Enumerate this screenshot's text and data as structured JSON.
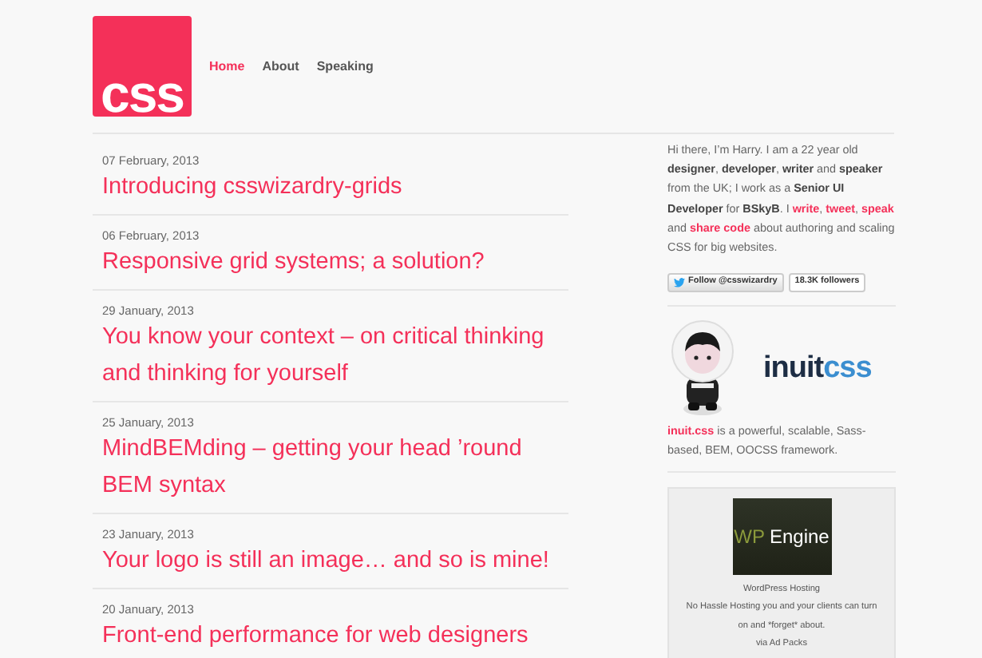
{
  "logo": {
    "text": "css"
  },
  "nav": [
    {
      "label": "Home",
      "selected": true
    },
    {
      "label": "About",
      "selected": false
    },
    {
      "label": "Speaking",
      "selected": false
    }
  ],
  "posts": [
    {
      "date": "07 February, 2013",
      "title": "Introducing csswizardry-grids"
    },
    {
      "date": "06 February, 2013",
      "title": "Responsive grid systems; a solution?"
    },
    {
      "date": "29 January, 2013",
      "title": "You know your context – on critical thinking and thinking for yourself"
    },
    {
      "date": "25 January, 2013",
      "title": "MindBEMding – getting your head ’round BEM syntax"
    },
    {
      "date": "23 January, 2013",
      "title": "Your logo is still an image… and so is mine!"
    },
    {
      "date": "20 January, 2013",
      "title": "Front-end performance for web designers"
    }
  ],
  "sidebar": {
    "bio": [
      {
        "kind": "text",
        "text": "Hi there, I’m Harry. I am a 22 year old "
      },
      {
        "kind": "bold",
        "text": "designer"
      },
      {
        "kind": "text",
        "text": ", "
      },
      {
        "kind": "bold",
        "text": "developer"
      },
      {
        "kind": "text",
        "text": ", "
      },
      {
        "kind": "bold",
        "text": "writer"
      },
      {
        "kind": "text",
        "text": " and "
      },
      {
        "kind": "bold",
        "text": "speaker"
      },
      {
        "kind": "text",
        "text": " from the UK; I work as a "
      },
      {
        "kind": "bold",
        "text": "Senior UI Developer"
      },
      {
        "kind": "text",
        "text": " for "
      },
      {
        "kind": "bold",
        "text": "BSkyB"
      },
      {
        "kind": "text",
        "text": ". I "
      },
      {
        "kind": "link",
        "text": "write"
      },
      {
        "kind": "text",
        "text": ", "
      },
      {
        "kind": "link",
        "text": "tweet"
      },
      {
        "kind": "text",
        "text": ", "
      },
      {
        "kind": "link",
        "text": "speak"
      },
      {
        "kind": "text",
        "text": " and "
      },
      {
        "kind": "link",
        "text": "share code"
      },
      {
        "kind": "text",
        "text": " about authoring and scaling CSS for big websites."
      }
    ],
    "follow_button": "Follow @csswizardry",
    "followers": "18.3K followers",
    "inuit_logo": {
      "part_1": "inuit",
      "part_2": "css"
    },
    "inuit_text": [
      {
        "kind": "link",
        "text": "inuit.css"
      },
      {
        "kind": "text",
        "text": " is a powerful, scalable, Sass-based, BEM, OOCSS framework."
      }
    ],
    "ad": {
      "logo_part_1": "WP",
      "logo_part_2": "Engine",
      "title": "WordPress Hosting",
      "description": "No Hassle Hosting you and your clients can turn on and *forget* about.",
      "via": "via Ad Packs"
    }
  }
}
